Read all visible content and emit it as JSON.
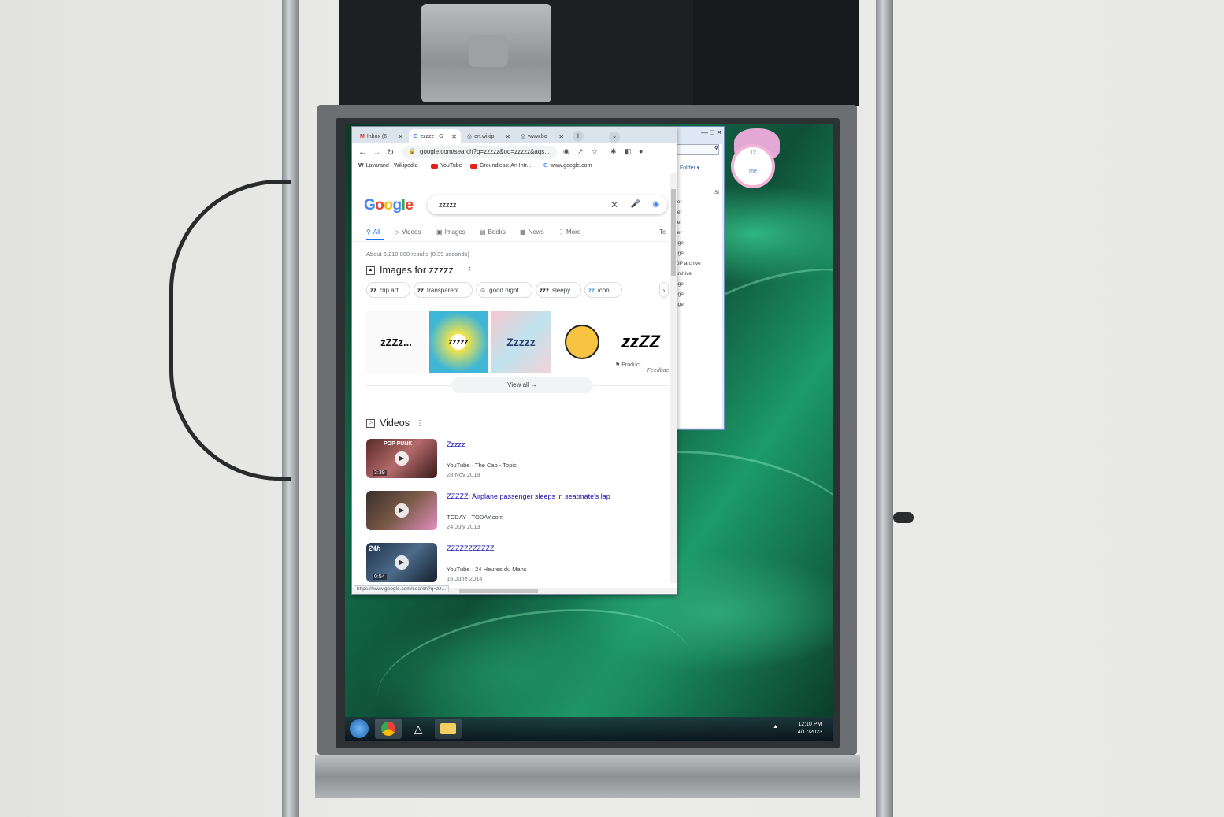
{
  "browser": {
    "tabs": [
      {
        "label": "Inbox (6",
        "icon": "gmail-icon"
      },
      {
        "label": "zzzzz - G",
        "icon": "google-icon"
      },
      {
        "label": "en.wikip",
        "icon": "globe-icon"
      },
      {
        "label": "www.bo",
        "icon": "globe-icon"
      }
    ],
    "new_tab_label": "+",
    "url": "google.com/search?q=zzzzz&oq=zzzzz&aqs...",
    "bookmarks": [
      {
        "label": "Lavarand - Wikipedia",
        "icon": "W"
      },
      {
        "label": "YouTube",
        "icon": "youtube-icon"
      },
      {
        "label": "Groundless: An Intr...",
        "icon": "youtube-icon"
      },
      {
        "label": "www.google.com",
        "icon": "G"
      }
    ],
    "status_url": "https://www.google.com/search?q=zz..."
  },
  "search": {
    "logo": "Google",
    "query": "zzzzz",
    "tabs": [
      "All",
      "Videos",
      "Images",
      "Books",
      "News",
      "More"
    ],
    "tools_label": "Tc",
    "stats": "About 6,210,000 results (0.39 seconds)",
    "images_heading": "Images for zzzzz",
    "chips": [
      {
        "label": "clip art",
        "icon": "zᴢ"
      },
      {
        "label": "transparent",
        "icon": "zz"
      },
      {
        "label": "good night",
        "icon": "☺"
      },
      {
        "label": "sleepy",
        "icon": "zzᴢ"
      },
      {
        "label": "icon",
        "icon": "zᴢ"
      }
    ],
    "thumb_texts": [
      "zZZz...",
      "zzzzz",
      "Zzzzz",
      "",
      "zzZZ"
    ],
    "product_label": "Product",
    "feedback": "Feedbac",
    "view_all": "View all",
    "videos_heading": "Videos",
    "videos": [
      {
        "title": "Zzzzz",
        "source": "YouTube · The Cab - Topic",
        "date": "28 Nov 2019",
        "duration": "3:39",
        "badge": "POP PUNK"
      },
      {
        "title": "ZZZZZ: Airplane passenger sleeps in seatmate's lap",
        "source": "TODAY · TODAY.com",
        "date": "24 July 2013",
        "duration": "",
        "badge": ""
      },
      {
        "title": "ZZZZZZZZZZZ",
        "source": "YouTube · 24 Heures du Mans",
        "date": "15 June 2014",
        "duration": "0:54",
        "badge": "24h"
      }
    ]
  },
  "explorer": {
    "folder_label": "Folder",
    "size_label": "Si",
    "rows": [
      "ller",
      "ller",
      "ller",
      "ller",
      "age",
      "age",
      "ZIP archive",
      "archive",
      "age",
      "age",
      "age"
    ]
  },
  "gadget": {
    "clock_number": "12",
    "clock_brand": "me"
  },
  "taskbar": {
    "time": "12:10 PM",
    "date": "4/17/2023",
    "tray": "▲"
  }
}
